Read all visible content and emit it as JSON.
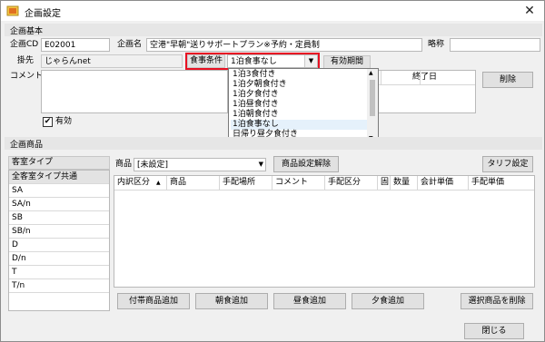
{
  "window": {
    "title": "企画設定",
    "close": "✕"
  },
  "plan_basic": {
    "section_label": "企画基本",
    "plan_cd_label": "企画CD",
    "plan_cd_value": "E02001",
    "plan_name_label": "企画名",
    "plan_name_value": "空港\"早朝\"送りサポートプラン※予約・定員制",
    "short_label": "略称",
    "short_value": "",
    "client_label": "掛先",
    "client_value": "じゃらんnet",
    "meal_label": "食事条件",
    "meal_value": "1泊食事なし",
    "validity_label": "有効期間",
    "end_date_label": "終了日",
    "comment_label": "コメント",
    "delete_label": "削除",
    "active_label": "有効",
    "active_checked": "✔"
  },
  "meal_dropdown": {
    "options": [
      "1泊3食付き",
      "1泊夕朝食付き",
      "1泊夕食付き",
      "1泊昼食付き",
      "1泊朝食付き",
      "1泊食事なし",
      "日帰り昼夕食付き"
    ],
    "selected_index": 5
  },
  "plan_products": {
    "section_label": "企画商品",
    "room_type_header": "客室タイプ",
    "room_types": [
      "全客室タイプ共通",
      "SA",
      "SA/n",
      "SB",
      "SB/n",
      "D",
      "D/n",
      "T",
      "T/n"
    ],
    "product_label": "商品",
    "product_value": "[未設定]",
    "product_reset_label": "商品設定解除",
    "tariff_label": "タリフ設定",
    "columns": [
      "内訳区分",
      "商品",
      "手配場所",
      "コメント",
      "手配区分",
      "固",
      "数量",
      "会計単価",
      "手配単価"
    ],
    "sort_arrow": "▲",
    "buttons": {
      "add_extra": "付帯商品追加",
      "add_breakfast": "朝食追加",
      "add_lunch": "昼食追加",
      "add_dinner": "夕食追加",
      "delete_selected": "選択商品を削除"
    }
  },
  "footer": {
    "close_label": "閉じる"
  }
}
